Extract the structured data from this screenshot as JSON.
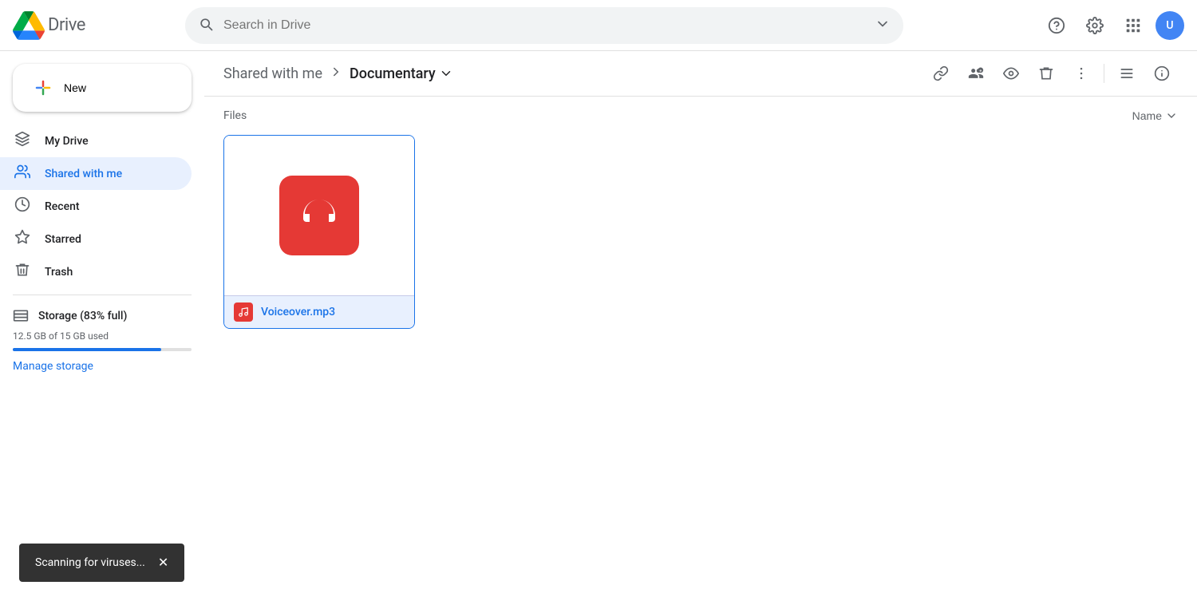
{
  "header": {
    "logo_text": "Drive",
    "search_placeholder": "Search in Drive"
  },
  "sidebar": {
    "new_button_label": "New",
    "items": [
      {
        "id": "my-drive",
        "label": "My Drive",
        "icon": "drive"
      },
      {
        "id": "shared-with-me",
        "label": "Shared with me",
        "icon": "people"
      },
      {
        "id": "recent",
        "label": "Recent",
        "icon": "clock"
      },
      {
        "id": "starred",
        "label": "Starred",
        "icon": "star"
      },
      {
        "id": "trash",
        "label": "Trash",
        "icon": "trash"
      }
    ],
    "storage": {
      "label": "Storage (83% full)",
      "used_text": "12.5 GB of 15 GB used",
      "fill_percent": 83,
      "manage_label": "Manage storage"
    }
  },
  "breadcrumb": {
    "parent": "Shared with me",
    "current": "Documentary"
  },
  "toolbar": {
    "buttons": [
      {
        "id": "get-link",
        "icon": "link"
      },
      {
        "id": "share",
        "icon": "person-add"
      },
      {
        "id": "preview",
        "icon": "eye"
      },
      {
        "id": "delete",
        "icon": "trash"
      },
      {
        "id": "more",
        "icon": "more-vert"
      }
    ],
    "view_toggle": "list",
    "info": "info"
  },
  "files": {
    "section_label": "Files",
    "sort_label": "Name",
    "items": [
      {
        "id": "voiceover-mp3",
        "name": "Voiceover.mp3",
        "type": "audio",
        "selected": true
      }
    ]
  },
  "toast": {
    "message": "Scanning for viruses...",
    "close_label": "✕"
  }
}
